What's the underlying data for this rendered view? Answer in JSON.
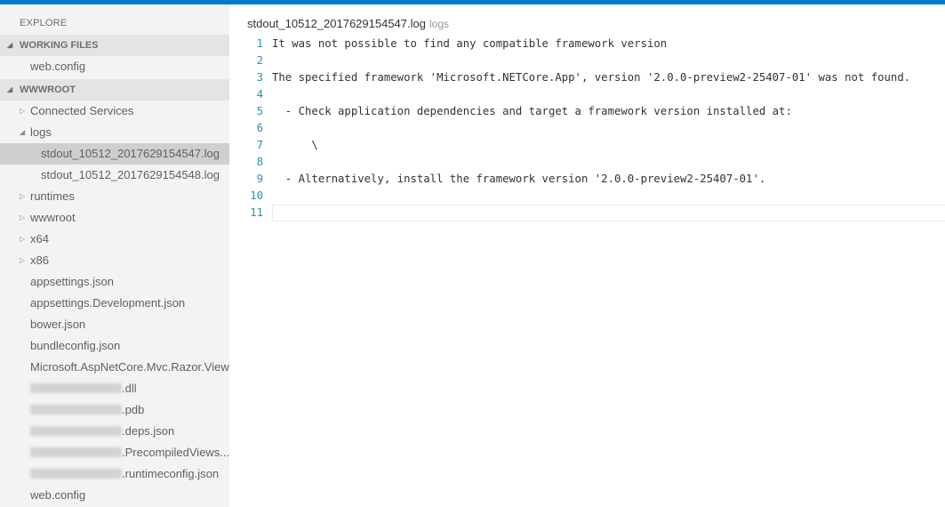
{
  "explorer": {
    "title": "EXPLORE",
    "working_files": {
      "label": "WORKING FILES",
      "items": [
        "web.config"
      ]
    },
    "root": {
      "label": "WWWROOT",
      "connected_services": "Connected Services",
      "logs": "logs",
      "log_files": [
        "stdout_10512_2017629154547.log",
        "stdout_10512_2017629154548.log"
      ],
      "folders": [
        "runtimes",
        "wwwroot",
        "x64",
        "x86"
      ],
      "files": [
        "appsettings.json",
        "appsettings.Development.json",
        "bower.json",
        "bundleconfig.json",
        "Microsoft.AspNetCore.Mvc.Razor.View..."
      ],
      "redacted_files": [
        ".dll",
        ".pdb",
        ".deps.json",
        ".PrecompiledViews....",
        ".runtimeconfig.json"
      ],
      "last_file": "web.config"
    }
  },
  "editor": {
    "filename": "stdout_10512_2017629154547.log",
    "folder": "logs",
    "lines": [
      {
        "n": "1",
        "text": "It was not possible to find any compatible framework version"
      },
      {
        "n": "2",
        "text": ""
      },
      {
        "n": "3",
        "text": "The specified framework 'Microsoft.NETCore.App', version '2.0.0-preview2-25407-01' was not found."
      },
      {
        "n": "4",
        "text": ""
      },
      {
        "n": "5",
        "text": "  - Check application dependencies and target a framework version installed at:"
      },
      {
        "n": "6",
        "text": ""
      },
      {
        "n": "7",
        "text": "      \\"
      },
      {
        "n": "8",
        "text": ""
      },
      {
        "n": "9",
        "text": "  - Alternatively, install the framework version '2.0.0-preview2-25407-01'."
      },
      {
        "n": "10",
        "text": ""
      },
      {
        "n": "11",
        "text": ""
      }
    ]
  },
  "colors": {
    "accent": "#007acc",
    "sidebar_bg": "#f3f3f3",
    "section_bg": "#e4e4e4",
    "selected_bg": "#cfcfd2",
    "line_number": "#2b91af"
  }
}
